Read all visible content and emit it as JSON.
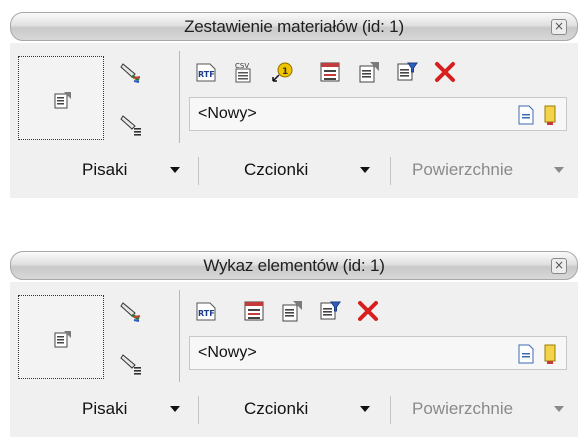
{
  "panels": [
    {
      "title": "Zestawienie materiałów (id: 1)",
      "close_icon": "close-icon",
      "toolbar_icons": [
        "rtf-export-icon",
        "csv-export-icon",
        "pointer-number-icon",
        "list-view-icon",
        "properties-icon",
        "filter-icon",
        "delete-icon"
      ],
      "combo_value": "<Nowy>",
      "bottom": {
        "pens": "Pisaki",
        "fonts": "Czcionki",
        "surfaces": "Powierzchnie"
      }
    },
    {
      "title": "Wykaz elementów (id: 1)",
      "close_icon": "close-icon",
      "toolbar_icons": [
        "rtf-export-icon",
        "list-view-icon",
        "properties-icon",
        "filter-icon",
        "delete-icon"
      ],
      "combo_value": "<Nowy>",
      "bottom": {
        "pens": "Pisaki",
        "fonts": "Czcionki",
        "surfaces": "Powierzchnie"
      }
    }
  ],
  "colors": {
    "panel_bg": "#f0f0f0",
    "delete_red": "#d81e1e",
    "disabled_text": "#8a8a8a"
  }
}
